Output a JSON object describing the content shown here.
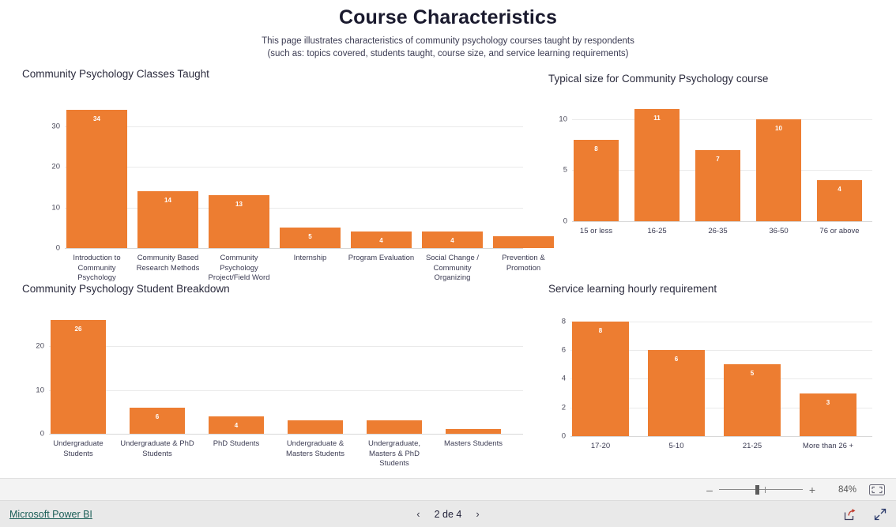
{
  "report": {
    "title": "Course Characteristics",
    "subtitle_line1": "This page illustrates characteristics of community psychology courses taught by respondents",
    "subtitle_line2": "(such as: topics covered, students taught, course size, and service learning requirements)",
    "accent_color": "#ED7D31",
    "grid_color": "#eaeaea"
  },
  "toolbar": {
    "zoom_out_label": "–",
    "zoom_in_label": "+",
    "zoom_percent": "84%",
    "fit_icon": "fit-to-page-icon"
  },
  "footer": {
    "brand": "Microsoft Power BI",
    "prev_label": "‹",
    "next_label": "›",
    "page_label": "2 de 4",
    "share_icon": "share-icon",
    "fullscreen_icon": "fullscreen-icon"
  },
  "chart_data": [
    {
      "id": "classes-taught",
      "type": "bar",
      "title": "Community Psychology Classes Taught",
      "xlabel": "",
      "ylabel": "",
      "ylim": [
        0,
        37
      ],
      "yticks": [
        0,
        10,
        20,
        30
      ],
      "grid": true,
      "legend": "none",
      "categories": [
        "Introduction to Community Psychology",
        "Community Based Research Methods",
        "Community Psychology Project/Field Word",
        "Internship",
        "Program Evaluation",
        "Social Change / Community Organizing",
        "Prevention & Promotion"
      ],
      "values": [
        34,
        14,
        13,
        5,
        4,
        4,
        3
      ],
      "labels": [
        "34",
        "14",
        "13",
        "5",
        "4",
        "4",
        ""
      ]
    },
    {
      "id": "typical-size",
      "type": "bar",
      "title": "Typical size for Community Psychology course",
      "xlabel": "",
      "ylabel": "",
      "ylim": [
        0,
        12
      ],
      "yticks": [
        0,
        5,
        10
      ],
      "grid": true,
      "legend": "none",
      "categories": [
        "15 or less",
        "16-25",
        "26-35",
        "36-50",
        "76 or above"
      ],
      "values": [
        8,
        11,
        7,
        10,
        4
      ],
      "labels": [
        "8",
        "11",
        "7",
        "10",
        "4"
      ]
    },
    {
      "id": "student-breakdown",
      "type": "bar",
      "title": "Community Psychology Student Breakdown",
      "xlabel": "",
      "ylabel": "",
      "ylim": [
        0,
        28
      ],
      "yticks": [
        0,
        10,
        20
      ],
      "grid": true,
      "legend": "none",
      "categories": [
        "Undergraduate Students",
        "Undergraduate & PhD Students",
        "PhD Students",
        "Undergraduate & Masters Students",
        "Undergraduate, Masters & PhD Students",
        "Masters Students"
      ],
      "values": [
        26,
        6,
        4,
        3,
        3,
        1
      ],
      "labels": [
        "26",
        "6",
        "4",
        "",
        "",
        ""
      ]
    },
    {
      "id": "service-learning",
      "type": "bar",
      "title": "Service learning hourly requirement",
      "xlabel": "",
      "ylabel": "",
      "ylim": [
        0,
        8.6
      ],
      "yticks": [
        0,
        2,
        4,
        6,
        8
      ],
      "grid": true,
      "legend": "none",
      "categories": [
        "17-20",
        "5-10",
        "21-25",
        "More than 26 +"
      ],
      "values": [
        8,
        6,
        5,
        3
      ],
      "labels": [
        "8",
        "6",
        "5",
        "3"
      ]
    }
  ]
}
